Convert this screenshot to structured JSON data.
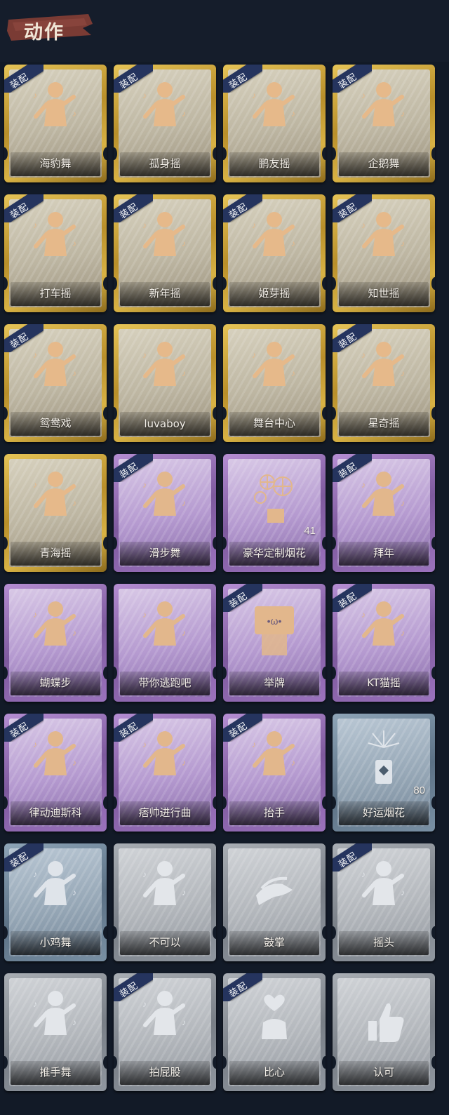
{
  "header": {
    "title": "动作"
  },
  "badge_label": "装配",
  "colors": {
    "gold": "#c9a23a",
    "purple": "#8f68b2",
    "blue": "#6f8599",
    "gray": "#8b9198",
    "badge": "#25345e",
    "background": "#121a27"
  },
  "cards": [
    {
      "name": "海豹舞",
      "rarity": "gold",
      "equipped": true,
      "icon": "dancer-music-icon"
    },
    {
      "name": "孤身摇",
      "rarity": "gold",
      "equipped": true,
      "icon": "dancer-sparkle-icon"
    },
    {
      "name": "鹏友摇",
      "rarity": "gold",
      "equipped": true,
      "icon": "dancer-wave-icon"
    },
    {
      "name": "企鹅舞",
      "rarity": "gold",
      "equipped": true,
      "icon": "dancer-sway-icon"
    },
    {
      "name": "打车摇",
      "rarity": "gold",
      "equipped": true,
      "icon": "dancer-music-icon"
    },
    {
      "name": "新年摇",
      "rarity": "gold",
      "equipped": true,
      "icon": "dancer-music-icon"
    },
    {
      "name": "姬芽摇",
      "rarity": "gold",
      "equipped": true,
      "icon": "dancer-wave-icon"
    },
    {
      "name": "知世摇",
      "rarity": "gold",
      "equipped": true,
      "icon": "dancer-music-icon"
    },
    {
      "name": "鸳鸯戏",
      "rarity": "gold",
      "equipped": true,
      "icon": "dancer-music-icon"
    },
    {
      "name": "luvaboy",
      "rarity": "gold",
      "equipped": false,
      "icon": "dancer-sparkle-icon"
    },
    {
      "name": "舞台中心",
      "rarity": "gold",
      "equipped": false,
      "icon": "dancer-sparkle-icon"
    },
    {
      "name": "星奇摇",
      "rarity": "gold",
      "equipped": true,
      "icon": "dancer-sparkle-icon"
    },
    {
      "name": "青海摇",
      "rarity": "gold",
      "equipped": false,
      "icon": "dancer-sparkle-icon"
    },
    {
      "name": "滑步舞",
      "rarity": "purple",
      "equipped": true,
      "icon": "dancer-music-icon"
    },
    {
      "name": "豪华定制烟花",
      "rarity": "purple",
      "equipped": false,
      "icon": "fireworks-box-icon",
      "count": "41"
    },
    {
      "name": "拜年",
      "rarity": "purple",
      "equipped": true,
      "icon": "figure-bow-icon"
    },
    {
      "name": "蝴蝶步",
      "rarity": "purple",
      "equipped": false,
      "icon": "figure-point-icon"
    },
    {
      "name": "带你逃跑吧",
      "rarity": "purple",
      "equipped": false,
      "icon": "dancer-music-icon"
    },
    {
      "name": "举牌",
      "rarity": "purple",
      "equipped": true,
      "icon": "sign-board-icon"
    },
    {
      "name": "KT猫摇",
      "rarity": "purple",
      "equipped": true,
      "icon": "dancer-music-icon"
    },
    {
      "name": "律动迪斯科",
      "rarity": "purple",
      "equipped": true,
      "icon": "dancer-music-icon"
    },
    {
      "name": "痞帅进行曲",
      "rarity": "purple",
      "equipped": true,
      "icon": "dancer-music-icon"
    },
    {
      "name": "抬手",
      "rarity": "purple",
      "equipped": true,
      "icon": "raise-hand-icon"
    },
    {
      "name": "好运烟花",
      "rarity": "blue",
      "equipped": false,
      "icon": "firework-can-icon",
      "count": "80"
    },
    {
      "name": "小鸡舞",
      "rarity": "blue",
      "equipped": true,
      "icon": "figure-dance-icon"
    },
    {
      "name": "不可以",
      "rarity": "gray",
      "equipped": false,
      "icon": "finger-wag-icon"
    },
    {
      "name": "鼓掌",
      "rarity": "gray",
      "equipped": false,
      "icon": "clap-icon"
    },
    {
      "name": "摇头",
      "rarity": "gray",
      "equipped": true,
      "icon": "head-shake-icon"
    },
    {
      "name": "推手舞",
      "rarity": "gray",
      "equipped": false,
      "icon": "figure-push-icon"
    },
    {
      "name": "拍屁股",
      "rarity": "gray",
      "equipped": true,
      "icon": "figure-pat-icon"
    },
    {
      "name": "比心",
      "rarity": "gray",
      "equipped": true,
      "icon": "finger-heart-icon"
    },
    {
      "name": "认可",
      "rarity": "gray",
      "equipped": false,
      "icon": "thumbs-up-icon"
    }
  ]
}
